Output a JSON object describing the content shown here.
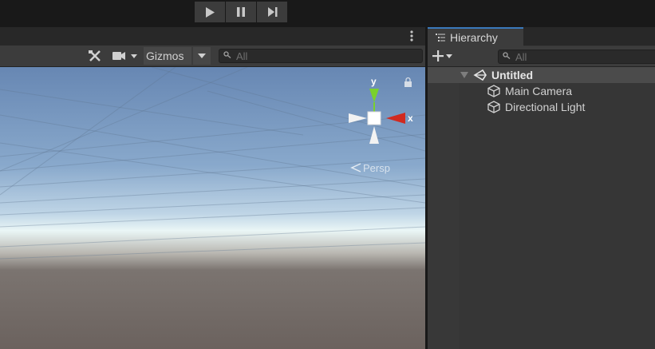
{
  "toolbar": {
    "play_icon": "play-icon",
    "pause_icon": "pause-icon",
    "step_icon": "step-icon"
  },
  "scene_view": {
    "menu_icon": "kebab-menu-icon",
    "tools_icon": "tools-icon",
    "camera_icon": "camera-icon",
    "gizmos_label": "Gizmos",
    "search_placeholder": "All",
    "gizmo": {
      "y_label": "y",
      "x_label": "x",
      "projection_label": "Persp"
    }
  },
  "hierarchy": {
    "tab_label": "Hierarchy",
    "tab_icon": "list-icon",
    "search_placeholder": "All",
    "scene": {
      "name": "Untitled",
      "icon": "unity-logo-icon"
    },
    "items": [
      {
        "label": "Main Camera",
        "icon": "gameobject-cube-icon"
      },
      {
        "label": "Directional Light",
        "icon": "gameobject-cube-icon"
      }
    ]
  },
  "colors": {
    "accent_blue": "#3a79bb",
    "gizmo_x": "#d12a20",
    "gizmo_y": "#7ad12b"
  }
}
